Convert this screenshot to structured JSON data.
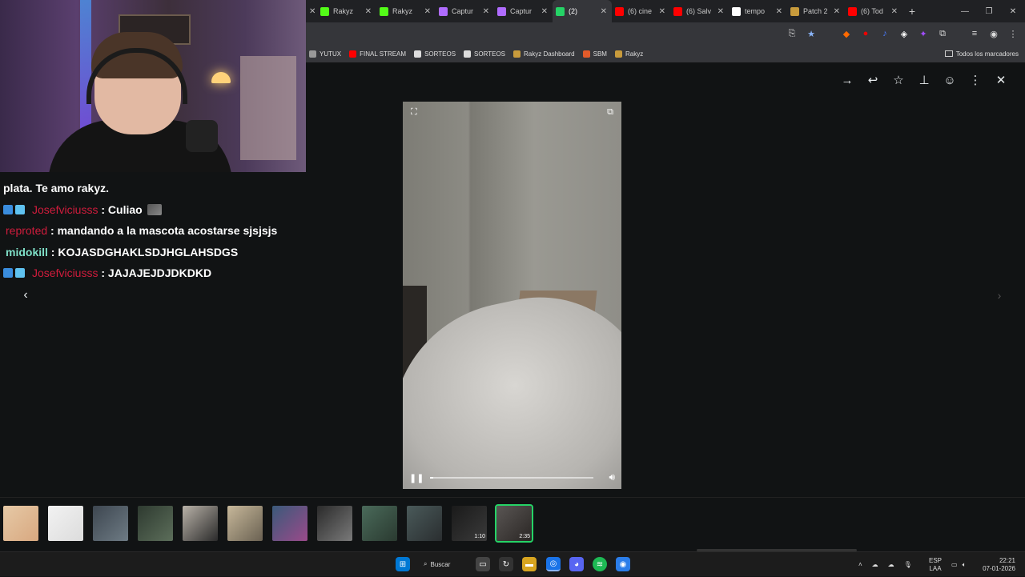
{
  "browser": {
    "tabs": [
      {
        "title": "Rakyz",
        "icon_color": "#53fc18",
        "icon": "kick-icon",
        "active": false
      },
      {
        "title": "Rakyz",
        "icon_color": "#53fc18",
        "icon": "kick-icon",
        "active": false
      },
      {
        "title": "Captur",
        "icon_color": "#b06cff",
        "icon": "pen-icon",
        "active": false
      },
      {
        "title": "Captur",
        "icon_color": "#b06cff",
        "icon": "pen-icon",
        "active": false
      },
      {
        "title": "(2)",
        "icon_color": "#25d366",
        "icon": "whatsapp-icon",
        "active": true
      },
      {
        "title": "(6) cine",
        "icon_color": "#ff0000",
        "icon": "youtube-icon",
        "active": false
      },
      {
        "title": "(6) Salv",
        "icon_color": "#ff0000",
        "icon": "youtube-icon",
        "active": false
      },
      {
        "title": "tempo",
        "icon_color": "#ffffff",
        "icon": "google-icon",
        "active": false
      },
      {
        "title": "Patch 2",
        "icon_color": "#c89b3c",
        "icon": "league-icon",
        "active": false
      },
      {
        "title": "(6) Tod",
        "icon_color": "#ff0000",
        "icon": "youtube-icon",
        "active": false
      }
    ],
    "new_tab": "+",
    "bookmarks": [
      {
        "label": "YUTUX",
        "color": "#999"
      },
      {
        "label": "FINAL STREAM",
        "color": "#ff0000"
      },
      {
        "label": "SORTEOS",
        "color": "#ddd"
      },
      {
        "label": "SORTEOS",
        "color": "#ddd"
      },
      {
        "label": "Rakyz Dashboard",
        "color": "#c89b3c"
      },
      {
        "label": "SBM",
        "color": "#e25b2a"
      },
      {
        "label": "Rakyz",
        "color": "#c89b3c"
      }
    ],
    "all_bookmarks": "Todos los marcadores"
  },
  "chat": {
    "lines": [
      {
        "user": "",
        "message": "plata. Te amo rakyz."
      },
      {
        "user": "Josefviciusss",
        "message": "Culiao",
        "user_color": "red",
        "badges": true,
        "emote": true
      },
      {
        "user": "reproted",
        "message": "mandando a la mascota acostarse sjsjsjs",
        "user_color": "red",
        "badges": false
      },
      {
        "user": "midokill",
        "message": "KOJASDGHAKLSDJHGLAHSDGS",
        "user_color": "teal",
        "badges": false
      },
      {
        "user": "Josefviciusss",
        "message": "JAJAJEJDJDKDKD",
        "user_color": "red",
        "badges": true
      }
    ]
  },
  "viewer": {
    "actions": [
      "forward-icon",
      "reply-icon",
      "star-icon",
      "pin-icon",
      "emoji-icon",
      "more-icon",
      "close-icon"
    ],
    "video_progress": 0.02
  },
  "thumbnails": [
    {
      "label": "",
      "colors": [
        "#e6c9a6",
        "#d8a880"
      ]
    },
    {
      "label": "",
      "colors": [
        "#f2f2f2",
        "#dcdcdc"
      ]
    },
    {
      "label": "",
      "colors": [
        "#3d4650",
        "#6e7b84"
      ]
    },
    {
      "label": "",
      "colors": [
        "#2e3a30",
        "#5c6e5a"
      ]
    },
    {
      "label": "",
      "colors": [
        "#b9b2a8",
        "#2a2a2a"
      ]
    },
    {
      "label": "",
      "colors": [
        "#c7b89a",
        "#6a6152"
      ]
    },
    {
      "label": "",
      "colors": [
        "#3a5a7a",
        "#9a4a8a"
      ]
    },
    {
      "label": "",
      "colors": [
        "#2a2a2a",
        "#7a7a7a"
      ]
    },
    {
      "label": "",
      "colors": [
        "#4a6a5a",
        "#2a3a30"
      ]
    },
    {
      "label": "",
      "colors": [
        "#4a5a5a",
        "#2a2e30"
      ]
    },
    {
      "label": "1:10",
      "colors": [
        "#1a1a1a",
        "#3a3a3a"
      ]
    },
    {
      "label": "2:35",
      "colors": [
        "#5a5654",
        "#2a2624"
      ],
      "selected": true
    }
  ],
  "taskbar": {
    "search_label": "Buscar",
    "lang_top": "ESP",
    "lang_bottom": "LAA",
    "time": "22:21",
    "date": "07-01-2026"
  }
}
